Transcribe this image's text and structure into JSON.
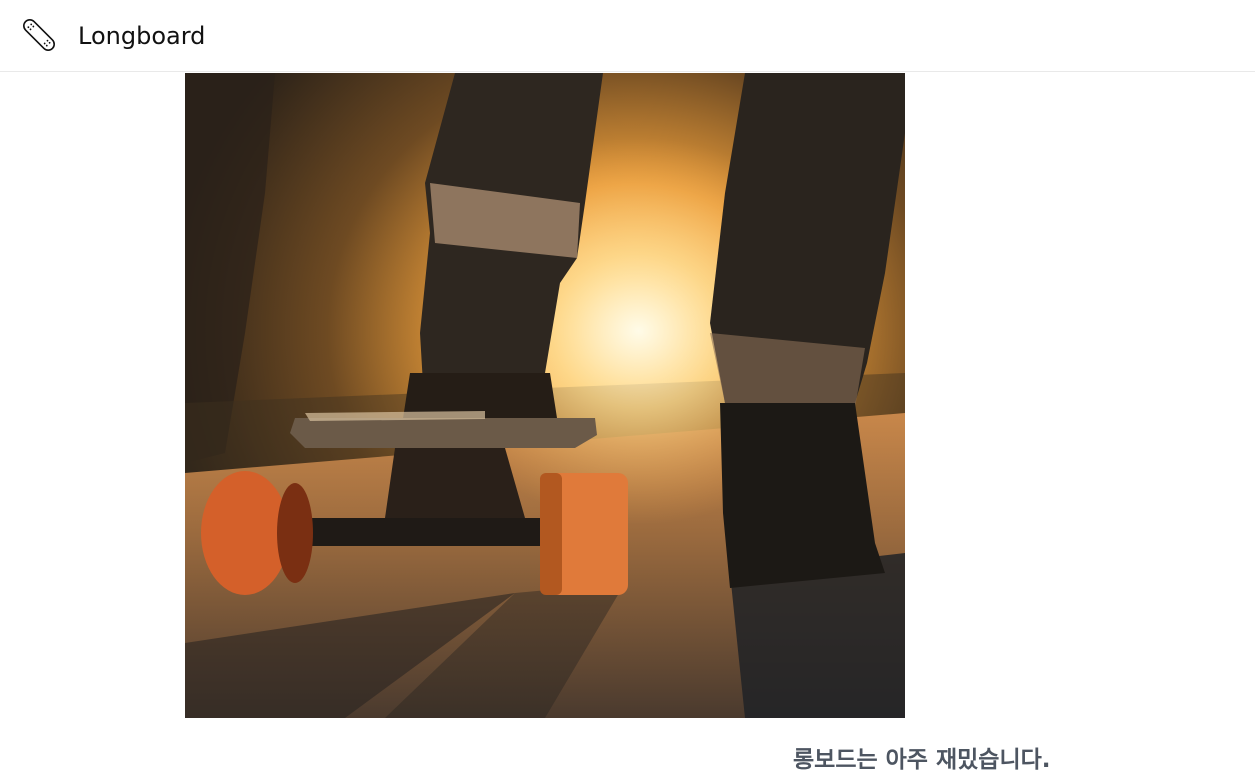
{
  "header": {
    "brand": "Longboard",
    "logo_icon": "skateboard-icon"
  },
  "hero": {
    "image": "longboard-sunset-photo"
  },
  "caption": {
    "text": "롱보드는 아주 재밌습니다."
  }
}
